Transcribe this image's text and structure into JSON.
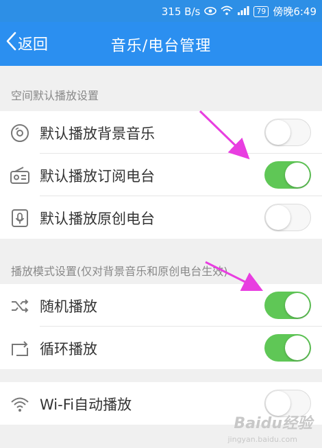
{
  "status_bar": {
    "network_speed": "315 B/s",
    "battery": "79",
    "time": "傍晚6:49"
  },
  "header": {
    "back_label": "返回",
    "title": "音乐/电台管理"
  },
  "section1": {
    "title": "空间默认播放设置",
    "items": [
      {
        "label": "默认播放背景音乐",
        "icon": "music-disc-icon",
        "enabled": false
      },
      {
        "label": "默认播放订阅电台",
        "icon": "radio-icon",
        "enabled": true
      },
      {
        "label": "默认播放原创电台",
        "icon": "microphone-icon",
        "enabled": false
      }
    ]
  },
  "section2": {
    "title": "播放模式设置(仅对背景音乐和原创电台生效)",
    "items": [
      {
        "label": "随机播放",
        "icon": "shuffle-icon",
        "enabled": true
      },
      {
        "label": "循环播放",
        "icon": "repeat-icon",
        "enabled": true
      }
    ]
  },
  "section3": {
    "items": [
      {
        "label": "Wi-Fi自动播放",
        "icon": "wifi-icon",
        "enabled": false
      }
    ]
  },
  "watermark": {
    "brand": "Baidu经验",
    "url": "jingyan.baidu.com"
  },
  "colors": {
    "header": "#2b8ff0",
    "switch_on": "#5fc756",
    "arrow": "#e83ee0"
  }
}
